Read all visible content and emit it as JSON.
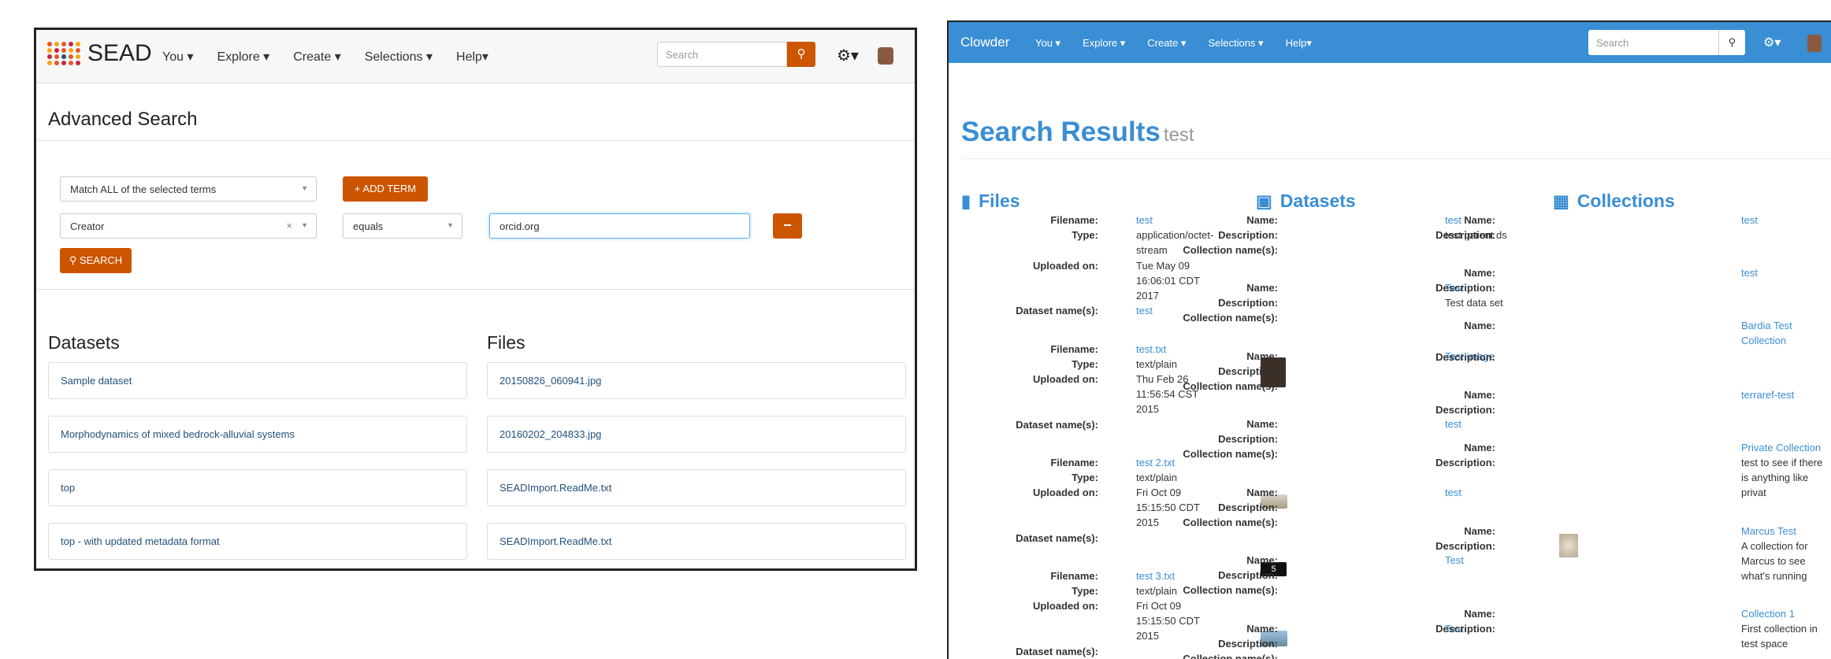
{
  "sead": {
    "logo_text": "SEAD",
    "nav": [
      "You ▾",
      "Explore ▾",
      "Create ▾",
      "Selections ▾",
      "Help▾"
    ],
    "search_placeholder": "Search",
    "page_title": "Advanced Search",
    "match_select": "Match ALL of the selected terms",
    "add_term_label": "+ ADD TERM",
    "field_select": "Creator",
    "clear_mark": "×",
    "operator_select": "equals",
    "search_value": "orcid.org",
    "remove_label": "−",
    "search_button": "SEARCH",
    "datasets_heading": "Datasets",
    "files_heading": "Files",
    "datasets": [
      "Sample dataset",
      "Morphodynamics of mixed bedrock-alluvial systems",
      "top",
      "top - with updated metadata format"
    ],
    "files": [
      "20150826_060941.jpg",
      "20160202_204833.jpg",
      "SEADImport.ReadMe.txt",
      "SEADImport.ReadMe.txt"
    ]
  },
  "clowder": {
    "brand": "Clowder",
    "nav": [
      "You ▾",
      "Explore ▾",
      "Create ▾",
      "Selections ▾",
      "Help▾"
    ],
    "search_placeholder": "Search",
    "title": "Search Results",
    "query": "test",
    "files_heading": "Files",
    "datasets_heading": "Datasets",
    "collections_heading": "Collections",
    "labels": {
      "filename": "Filename:",
      "type": "Type:",
      "uploaded": "Uploaded on:",
      "dataset_names": "Dataset name(s):",
      "name": "Name:",
      "description": "Description:",
      "collection_names": "Collection name(s):"
    },
    "files": [
      {
        "filename": "test",
        "type_l1": "application/octet-",
        "type_l2": "stream",
        "up1": "Tue May 09",
        "up2": "16:06:01 CDT",
        "up3": "2017",
        "dataset": "test"
      },
      {
        "filename": "test.txt",
        "type_l1": "text/plain",
        "up1": "Thu Feb 26",
        "up2": "11:56:54 CST",
        "up3": "2015"
      },
      {
        "filename": "test 2.txt",
        "type_l1": "text/plain",
        "up1": "Fri Oct 09",
        "up2": "15:15:50 CDT",
        "up3": "2015"
      },
      {
        "filename": "test 3.txt",
        "type_l1": "text/plain",
        "up1": "Fri Oct 09",
        "up2": "15:15:50 CDT",
        "up3": "2015"
      }
    ],
    "datasets": [
      {
        "name": "test",
        "desc": "test parent ds"
      },
      {
        "name": "Test",
        "desc": "Test data set"
      },
      {
        "name": "Test image",
        "desc": ""
      },
      {
        "name": "test",
        "desc": ""
      },
      {
        "name": "test",
        "desc": ""
      },
      {
        "name": "Test",
        "desc": ""
      },
      {
        "name": "Test",
        "desc": ""
      }
    ],
    "thumb5_label": "5",
    "collections": [
      {
        "name": "test",
        "d1": ""
      },
      {
        "name": "test",
        "d1": ""
      },
      {
        "name": "Bardia Test",
        "name2": "Collection",
        "d1": ""
      },
      {
        "name": "terraref-test",
        "d1": ""
      },
      {
        "name": "Private Collection",
        "d1": "test to see if there",
        "d2": "is anything like",
        "d3": "privat"
      },
      {
        "name": "Marcus Test",
        "d1": "A collection for",
        "d2": "Marcus to see",
        "d3": "what's running"
      },
      {
        "name": "Collection 1",
        "d1": "First collection in",
        "d2": "test space"
      }
    ]
  }
}
